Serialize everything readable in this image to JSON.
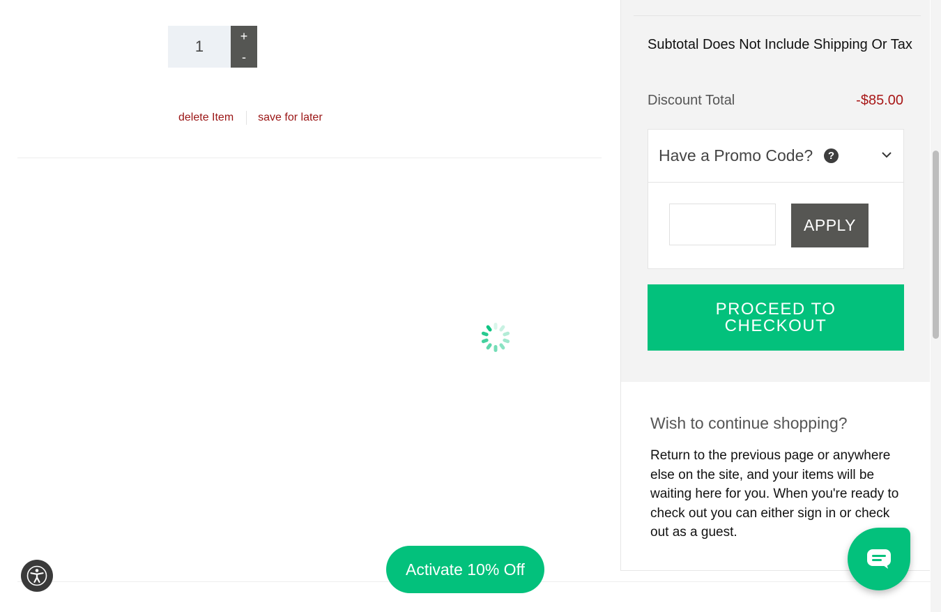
{
  "cart_item": {
    "quantity": "1",
    "increment_label": "+",
    "decrement_label": "-",
    "delete_label": "delete Item",
    "save_later_label": "save for later"
  },
  "summary": {
    "subtotal_note": "Subtotal Does Not Include Shipping Or Tax",
    "discount_label": "Discount Total",
    "discount_value": "-$85.00",
    "promo": {
      "title": "Have a Promo Code?",
      "help_icon": "?",
      "input_value": "",
      "apply_label": "APPLY"
    },
    "checkout_label": "PROCEED TO CHECKOUT"
  },
  "continue_shopping": {
    "title": "Wish to continue shopping?",
    "text": "Return to the previous page or anywhere else on the site, and your items will be waiting here for you. When you're ready to check out you can either sign in or check out as a guest."
  },
  "promo_banner": {
    "label": "Activate 10% Off"
  },
  "icons": {
    "accessibility": "accessibility-icon",
    "chat": "chat-icon",
    "help": "question-circle-icon",
    "chevron": "chevron-down-icon",
    "spinner": "loading-spinner-icon"
  },
  "colors": {
    "accent_green": "#03c17c",
    "dark_button": "#565653",
    "discount_red": "#a81717",
    "link_red": "#9a1414",
    "panel_bg": "#f3f3f3"
  }
}
